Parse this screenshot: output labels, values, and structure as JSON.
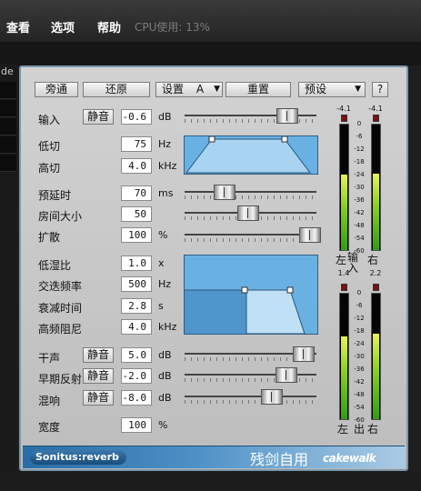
{
  "menu": {
    "items": [
      "查看",
      "选项",
      "帮助"
    ],
    "cpu": "CPU使用: 13%"
  },
  "side": {
    "label": "de"
  },
  "toolbar": {
    "bypass": "旁通",
    "restore": "还原",
    "setting_label": "设置",
    "setting_value": "A",
    "arrow": "▼",
    "reset": "重置",
    "preset": "预设",
    "help": "?"
  },
  "params": {
    "input": {
      "label": "输入",
      "mute": "静音",
      "value": "-0.6",
      "unit": "dB",
      "level": 0.78
    },
    "lowcut": {
      "label": "低切",
      "value": "75",
      "unit": "Hz"
    },
    "highcut": {
      "label": "高切",
      "value": "4.0",
      "unit": "kHz"
    },
    "predelay": {
      "label": "预延时",
      "value": "70",
      "unit": "ms",
      "level": 0.3
    },
    "roomsize": {
      "label": "房间大小",
      "value": "50",
      "unit": "",
      "level": 0.48
    },
    "diffusion": {
      "label": "扩散",
      "value": "100",
      "unit": "%",
      "level": 0.95
    },
    "lowratio": {
      "label": "低湿比",
      "value": "1.0",
      "unit": "x"
    },
    "crossover": {
      "label": "交迭频率",
      "value": "500",
      "unit": "Hz"
    },
    "decay": {
      "label": "衰减时间",
      "value": "2.8",
      "unit": "s"
    },
    "hfdamp": {
      "label": "高频阻尼",
      "value": "4.0",
      "unit": "kHz"
    },
    "dry": {
      "label": "干声",
      "mute": "静音",
      "value": "5.0",
      "unit": "dB",
      "level": 0.9
    },
    "early": {
      "label": "早期反射",
      "mute": "静音",
      "value": "-2.0",
      "unit": "dB",
      "level": 0.77
    },
    "reverb": {
      "label": "混响",
      "mute": "静音",
      "value": "-8.0",
      "unit": "dB",
      "level": 0.66
    },
    "width": {
      "label": "宽度",
      "value": "100",
      "unit": "%"
    }
  },
  "meters": {
    "input": {
      "peak_l": "-4.1",
      "peak_r": "-4.1",
      "label_l": "左",
      "label_mid": "输入",
      "label_r": "右",
      "fill_l": 0.6,
      "fill_r": 0.61
    },
    "output": {
      "peak_l": "1.4",
      "peak_r": "2.2",
      "label_l": "左",
      "label_mid": "出",
      "label_r": "右",
      "fill_l": 0.66,
      "fill_r": 0.68
    },
    "scale": [
      "0",
      "-6",
      "-12",
      "-18",
      "-24",
      "-30",
      "-36",
      "-42",
      "-48",
      "-54",
      "-60"
    ]
  },
  "footer": {
    "name": "Sonitus:reverb",
    "author": "残剑自用",
    "brand": "cakewalk"
  }
}
